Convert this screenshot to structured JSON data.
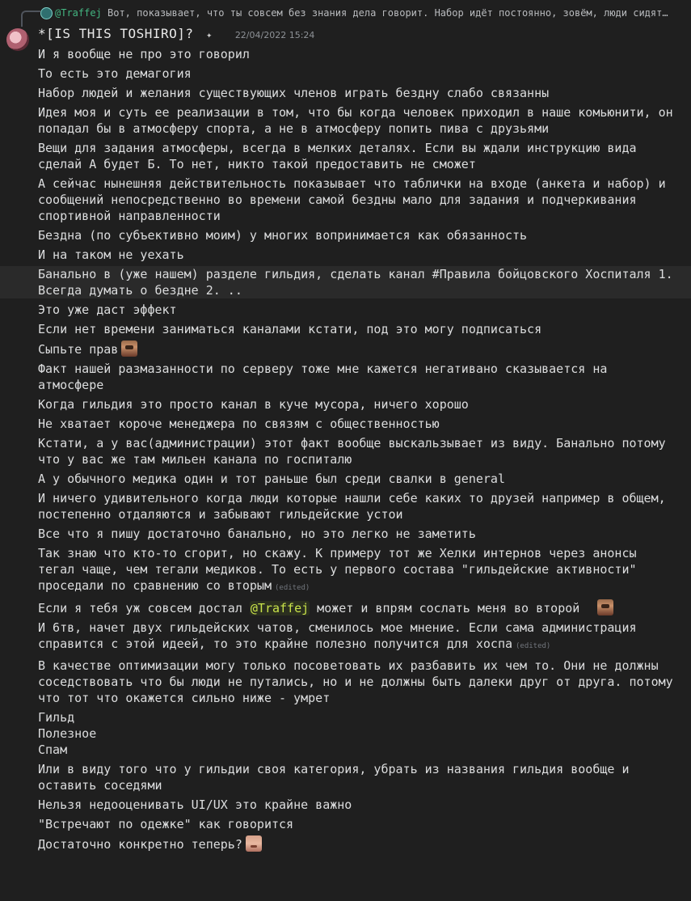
{
  "reply": {
    "author": "@Traffej",
    "text": "Вот, показывает, что ты совсем без знания дела говорит. Набор идёт постоянно, зовём, люди сидят…"
  },
  "header": {
    "username": "*[IS THIS TOSHIRO]?",
    "timestamp": "22/04/2022 15:24"
  },
  "edited_label": "(edited)",
  "mention": "@Traffej",
  "messages": [
    {
      "text": "И я вообще не про это говорил"
    },
    {
      "text": "То есть это демагогия"
    },
    {
      "text": "Набор людей и желания существующих членов играть бездну слабо связанны"
    },
    {
      "text": "Идея моя и суть ее реализации в том, что бы когда человек приходил в наше комьюнити, он попадал бы в атмосферу спорта, а не в атмосферу попить пива с друзьями"
    },
    {
      "text": "Вещи для задания атмосферы, всегда в мелких деталях. Если вы ждали инструкцию вида сделай А будет Б. То нет, никто такой предоставить не сможет"
    },
    {
      "text": "А сейчас нынешняя действительность показывает что таблички на входе (анкета и набор) и сообщений непосредственно во времени самой бездны  мало для задания и подчеркивания спортивной направленности"
    },
    {
      "text": "Бездна (по субъективно моим) у многих вопринимается как обязанность"
    },
    {
      "text": "И на таком не уехать"
    },
    {
      "text": "Банально в (уже нашем) разделе гильдия, сделать канал #Правила бойцовского Хоспиталя 1. Всегда думать о бездне 2. .."
    },
    {
      "text": "Это уже даст эффект"
    },
    {
      "text": "Если нет времени заниматься каналами кстати, под это могу подписаться"
    },
    {
      "text": "Сыпьте прав"
    },
    {
      "text": "Факт нашей размазанности по серверу тоже мне кажется негативано сказывается на атмосфере"
    },
    {
      "text": "Когда гильдия это просто канал в куче мусора, ничего хорошо"
    },
    {
      "text": "Не хватает короче менеджера по связям с общественностью"
    },
    {
      "text": "Кстати, а у вас(администрации) этот факт вообще выскальзывает из виду. Банально потому что у вас же там мильен канала по госпиталю"
    },
    {
      "text": "А у обычного медика один и тот раньше был среди свалки в  general"
    },
    {
      "text": "И ничего удивительного когда люди которые нашли себе каких то друзей например в общем, постепенно отдаляются и забывают гильдейские устои"
    },
    {
      "text": "Все что я пишу достаточно банально, но это легко не заметить"
    },
    {
      "text": "Так знаю что кто-то сгорит, но скажу. К примеру тот же Хелки интернов через анонсы тегал чаще, чем тегали медиков. То есть у первого состава \"гильдейские активности\" проседали по сравнению со вторым"
    },
    {
      "before": "Если я тебя уж совсем достал ",
      "after": " может и впрям сослать меня во второй"
    },
    {
      "text": "И 6тв, начет двух гильдейских чатов, сменилось мое мнение. Если сама администрация справится с этой идеей, то это крайне полезно получится для хоспа"
    },
    {
      "text": "В качестве оптимизации могу только посоветовать их разбавить их чем то. Они не должны соседствовать что бы люди не путались, но и не должны быть далеки друг от друга. потому что тот что окажется сильно ниже - умрет"
    },
    {
      "text": "Гильд"
    },
    {
      "text": "Полезное"
    },
    {
      "text": "Спам"
    },
    {
      "text": "Или в виду того что у гильдии своя категория, убрать из названия гильдия вообще и оставить соседями"
    },
    {
      "text": "Нельзя недооценивать UI/UX это крайне важно"
    },
    {
      "text": "\"Встречают по одежке\" как говорится"
    },
    {
      "text": "Достаточно конкретно теперь?"
    }
  ]
}
